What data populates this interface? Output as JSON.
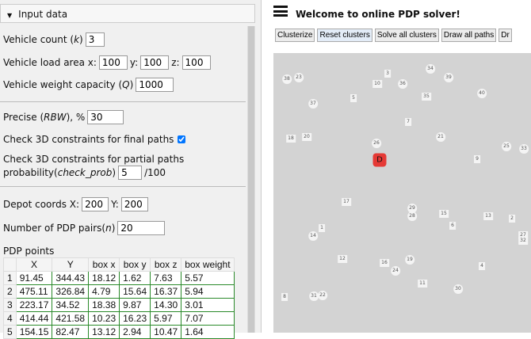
{
  "panel": {
    "title": "Input data"
  },
  "form": {
    "vehicle_count_label": "Vehicle count (",
    "vehicle_count_var": "k",
    "close_paren": ")",
    "vehicle_count": "3",
    "load_area_label": "Vehicle load area x:",
    "load_x": "100",
    "y_label": "y:",
    "load_y": "100",
    "z_label": "z:",
    "load_z": "100",
    "weight_label": "Vehicle weight capacity (",
    "weight_var": "Q",
    "weight": "1000",
    "precise_label": "Precise (",
    "precise_var": "RBW",
    "precise_suffix": "), %",
    "precise": "30",
    "check_final_label": "Check 3D constraints for final paths",
    "check_partial_label": "Check 3D constraints for partial paths",
    "prob_label": "probability(",
    "prob_var": "check_prob",
    "prob": "5",
    "prob_suffix": "/100",
    "depot_label": "Depot coords X:",
    "depot_x": "200",
    "depot_y_label": "Y:",
    "depot_y": "200",
    "pairs_label": "Number of PDP pairs(",
    "pairs_var": "n",
    "pairs": "20"
  },
  "table": {
    "title": "PDP points",
    "headers": [
      "",
      "X",
      "Y",
      "box x",
      "box y",
      "box z",
      "box weight"
    ],
    "rows": [
      [
        "1",
        "91.45",
        "344.43",
        "18.12",
        "1.62",
        "7.63",
        "5.57"
      ],
      [
        "2",
        "475.11",
        "326.84",
        "4.79",
        "15.64",
        "16.37",
        "5.94"
      ],
      [
        "3",
        "223.17",
        "34.52",
        "18.38",
        "9.87",
        "14.30",
        "3.01"
      ],
      [
        "4",
        "414.44",
        "421.58",
        "10.23",
        "16.23",
        "5.97",
        "7.07"
      ],
      [
        "5",
        "154.15",
        "82.47",
        "13.12",
        "2.94",
        "10.47",
        "1.64"
      ]
    ]
  },
  "header": {
    "title": "Welcome to online PDP solver!"
  },
  "toolbar": {
    "buttons": [
      "Clusterize",
      "Reset clusters",
      "Solve all clusters",
      "Draw all paths",
      "Dr"
    ]
  },
  "map": {
    "depot": "D",
    "markers": [
      [
        "38",
        "c",
        17,
        33
      ],
      [
        "23",
        "c",
        32,
        31
      ],
      [
        "3",
        "s",
        144,
        26
      ],
      [
        "10",
        "s",
        131,
        39
      ],
      [
        "36",
        "c",
        163,
        39
      ],
      [
        "34",
        "c",
        198,
        20
      ],
      [
        "39",
        "c",
        221,
        31
      ],
      [
        "5",
        "s",
        101,
        57
      ],
      [
        "35",
        "s",
        193,
        55
      ],
      [
        "40",
        "c",
        263,
        51
      ],
      [
        "37",
        "c",
        50,
        64
      ],
      [
        "7",
        "s",
        170,
        87
      ],
      [
        "18",
        "s",
        22,
        108
      ],
      [
        "20",
        "s",
        42,
        106
      ],
      [
        "26",
        "c",
        130,
        114
      ],
      [
        "21",
        "c",
        211,
        106
      ],
      [
        "25",
        "c",
        294,
        118
      ],
      [
        "33",
        "c",
        316,
        121
      ],
      [
        "9",
        "s",
        257,
        134
      ],
      [
        "17",
        "s",
        92,
        188
      ],
      [
        "29",
        "c",
        175,
        196
      ],
      [
        "28",
        "c",
        175,
        206
      ],
      [
        "15",
        "s",
        215,
        203
      ],
      [
        "13",
        "s",
        271,
        206
      ],
      [
        "2",
        "s",
        301,
        209
      ],
      [
        "1",
        "s",
        61,
        221
      ],
      [
        "6",
        "s",
        226,
        218
      ],
      [
        "14",
        "c",
        50,
        231
      ],
      [
        "27",
        "s",
        315,
        230
      ],
      [
        "32",
        "s",
        315,
        237
      ],
      [
        "12",
        "s",
        87,
        260
      ],
      [
        "16",
        "s",
        140,
        265
      ],
      [
        "19",
        "c",
        172,
        261
      ],
      [
        "24",
        "c",
        154,
        275
      ],
      [
        "4",
        "s",
        263,
        269
      ],
      [
        "11",
        "s",
        188,
        291
      ],
      [
        "30",
        "c",
        233,
        298
      ],
      [
        "8",
        "s",
        14,
        308
      ],
      [
        "31",
        "c",
        51,
        307
      ],
      [
        "22",
        "c",
        62,
        306
      ]
    ]
  }
}
